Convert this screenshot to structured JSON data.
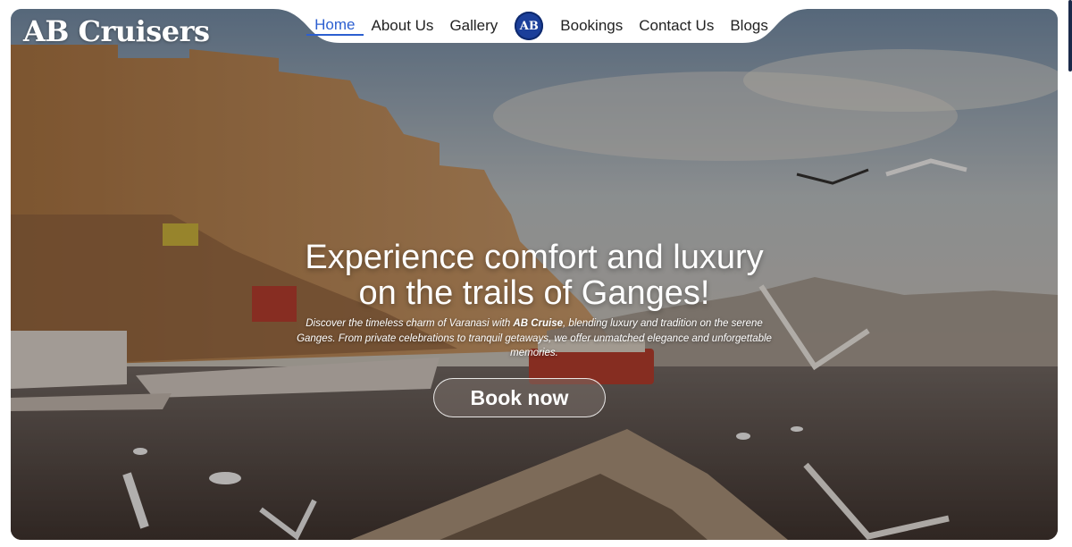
{
  "brand": {
    "name": "AB Cruisers",
    "logo_initials": "AB"
  },
  "nav": {
    "items": [
      {
        "label": "Home",
        "active": true
      },
      {
        "label": "About Us"
      },
      {
        "label": "Gallery"
      },
      {
        "label": "Bookings"
      },
      {
        "label": "Contact Us"
      },
      {
        "label": "Blogs"
      }
    ]
  },
  "hero": {
    "headline_line1": "Experience comfort and luxury",
    "headline_line2": "on the trails of Ganges!",
    "subtext_before": "Discover the timeless charm of Varanasi with ",
    "subtext_bold": "AB Cruise",
    "subtext_after": ", blending luxury and tradition on the serene Ganges. From private celebrations to tranquil getaways, we offer unmatched elegance and unforgettable memories.",
    "cta_label": "Book now",
    "background": "river-ghats-scene"
  },
  "colors": {
    "accent": "#2c5fd0",
    "logo_bg": "#1b3f9a",
    "nav_text": "#222222"
  }
}
